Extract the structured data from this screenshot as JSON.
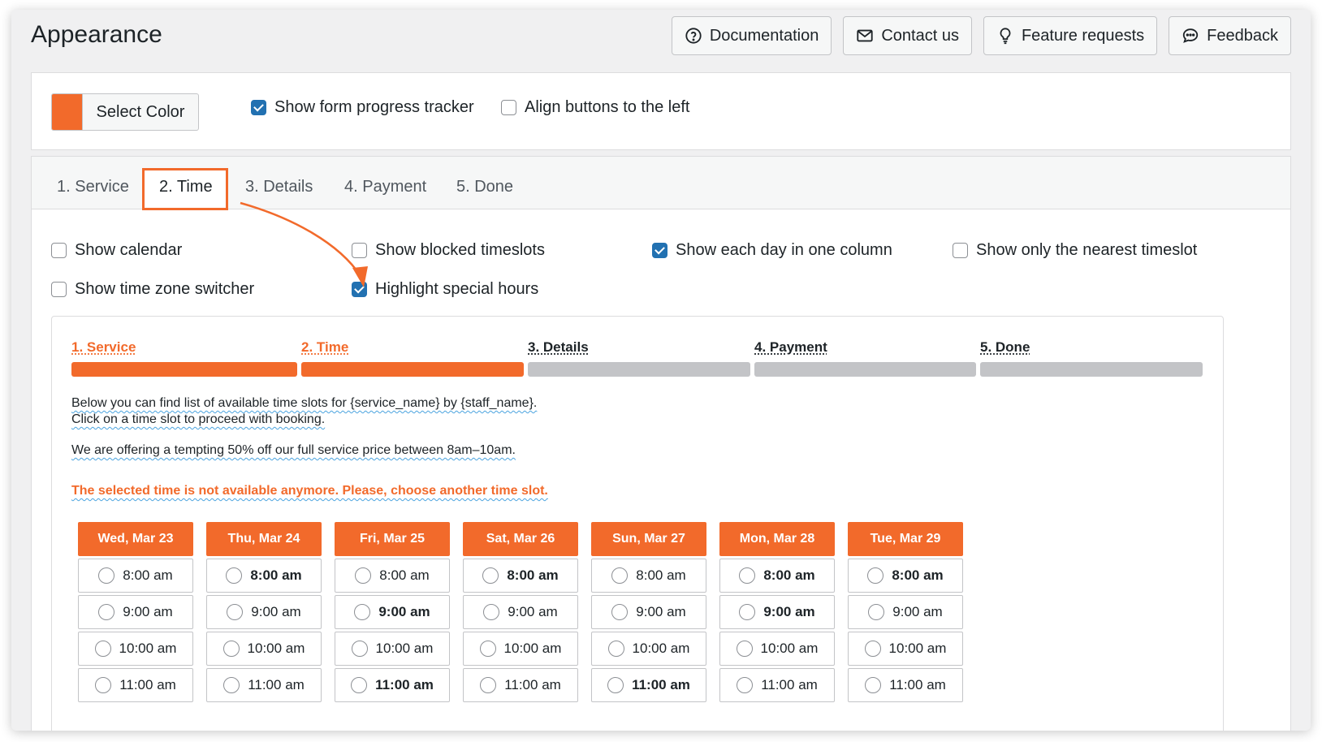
{
  "header": {
    "title": "Appearance",
    "buttons": [
      {
        "label": "Documentation",
        "icon": "question-circle-icon"
      },
      {
        "label": "Contact us",
        "icon": "envelope-icon"
      },
      {
        "label": "Feature requests",
        "icon": "lightbulb-icon"
      },
      {
        "label": "Feedback",
        "icon": "chat-bubble-icon"
      }
    ]
  },
  "colors": {
    "accent": "#f26a2b",
    "checkbox": "#2271b1",
    "inactive_bar": "#c3c4c7"
  },
  "settings": {
    "select_color_label": "Select Color",
    "show_progress_tracker": {
      "label": "Show form progress tracker",
      "checked": true
    },
    "align_buttons_left": {
      "label": "Align buttons to the left",
      "checked": false
    }
  },
  "tabs": [
    {
      "label": "1. Service",
      "active": false
    },
    {
      "label": "2. Time",
      "active": true
    },
    {
      "label": "3. Details",
      "active": false
    },
    {
      "label": "4. Payment",
      "active": false
    },
    {
      "label": "5. Done",
      "active": false
    }
  ],
  "time_options": {
    "show_calendar": {
      "label": "Show calendar",
      "checked": false
    },
    "show_blocked_timeslots": {
      "label": "Show blocked timeslots",
      "checked": false
    },
    "show_each_day_one_column": {
      "label": "Show each day in one column",
      "checked": true
    },
    "show_nearest_timeslot": {
      "label": "Show only the nearest timeslot",
      "checked": false
    },
    "show_timezone_switcher": {
      "label": "Show time zone switcher",
      "checked": false
    },
    "highlight_special_hours": {
      "label": "Highlight special hours",
      "checked": true
    }
  },
  "preview": {
    "steps": [
      {
        "label": "1. Service",
        "done": true
      },
      {
        "label": "2. Time",
        "done": true
      },
      {
        "label": "3. Details",
        "done": false
      },
      {
        "label": "4. Payment",
        "done": false
      },
      {
        "label": "5. Done",
        "done": false
      }
    ],
    "info_line1": "Below you can find list of available time slots for {service_name} by {staff_name}.",
    "info_line2": "Click on a time slot to proceed with booking.",
    "offer_text": "We are offering a tempting 50% off our full service price between 8am–10am.",
    "error_text": "The selected time is not available anymore. Please, choose another time slot.",
    "days": [
      {
        "label": "Wed, Mar 23",
        "slots": [
          {
            "time": "8:00 am",
            "hl": false
          },
          {
            "time": "9:00 am",
            "hl": false
          },
          {
            "time": "10:00 am",
            "hl": false
          },
          {
            "time": "11:00 am",
            "hl": false
          }
        ]
      },
      {
        "label": "Thu, Mar 24",
        "slots": [
          {
            "time": "8:00 am",
            "hl": true
          },
          {
            "time": "9:00 am",
            "hl": false
          },
          {
            "time": "10:00 am",
            "hl": false
          },
          {
            "time": "11:00 am",
            "hl": false
          }
        ]
      },
      {
        "label": "Fri, Mar 25",
        "slots": [
          {
            "time": "8:00 am",
            "hl": false
          },
          {
            "time": "9:00 am",
            "hl": true
          },
          {
            "time": "10:00 am",
            "hl": false
          },
          {
            "time": "11:00 am",
            "hl": true
          }
        ]
      },
      {
        "label": "Sat, Mar 26",
        "slots": [
          {
            "time": "8:00 am",
            "hl": true
          },
          {
            "time": "9:00 am",
            "hl": false
          },
          {
            "time": "10:00 am",
            "hl": false
          },
          {
            "time": "11:00 am",
            "hl": false
          }
        ]
      },
      {
        "label": "Sun, Mar 27",
        "slots": [
          {
            "time": "8:00 am",
            "hl": false
          },
          {
            "time": "9:00 am",
            "hl": false
          },
          {
            "time": "10:00 am",
            "hl": false
          },
          {
            "time": "11:00 am",
            "hl": true
          }
        ]
      },
      {
        "label": "Mon, Mar 28",
        "slots": [
          {
            "time": "8:00 am",
            "hl": true
          },
          {
            "time": "9:00 am",
            "hl": true
          },
          {
            "time": "10:00 am",
            "hl": false
          },
          {
            "time": "11:00 am",
            "hl": false
          }
        ]
      },
      {
        "label": "Tue, Mar 29",
        "slots": [
          {
            "time": "8:00 am",
            "hl": true
          },
          {
            "time": "9:00 am",
            "hl": false
          },
          {
            "time": "10:00 am",
            "hl": false
          },
          {
            "time": "11:00 am",
            "hl": false
          }
        ]
      }
    ]
  }
}
